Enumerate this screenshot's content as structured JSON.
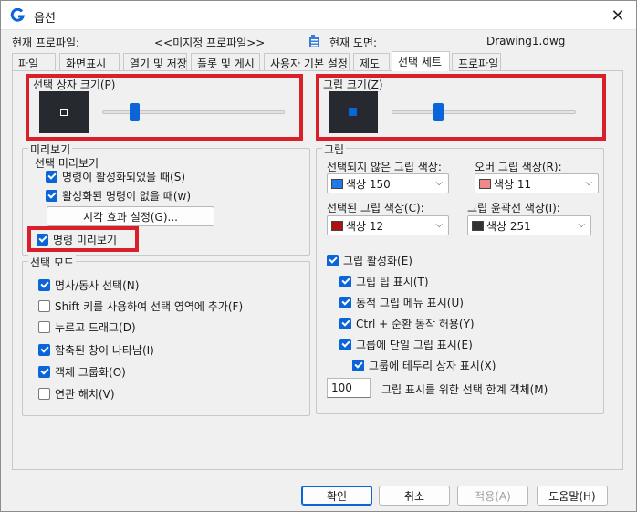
{
  "window": {
    "title": "옵션",
    "close_symbol": "✕"
  },
  "profile": {
    "current_profile_label": "현재 프로파일:",
    "current_profile_value": "<<미지정 프로파일>>",
    "current_drawing_label": "현재 도면:",
    "current_drawing_value": "Drawing1.dwg"
  },
  "tabs": [
    {
      "label": "파일"
    },
    {
      "label": "화면표시"
    },
    {
      "label": "열기 및 저장"
    },
    {
      "label": "플롯 및 게시"
    },
    {
      "label": "사용자 기본 설정"
    },
    {
      "label": "제도"
    },
    {
      "label": "선택 세트"
    },
    {
      "label": "프로파일"
    }
  ],
  "active_tab": "선택 세트",
  "pickbox": {
    "label": "선택 상자 크기(P)",
    "slider_value": 0.15
  },
  "gripsize": {
    "label": "그립 크기(Z)",
    "slider_value": 0.23
  },
  "preview": {
    "group_label": "미리보기",
    "sub_label": "선택 미리보기",
    "when_active": "명령이 활성화되었을 때(S)",
    "when_inactive": "활성화된 명령이 없을 때(w)",
    "visual_effects_button": "시각 효과 설정(G)...",
    "command_preview": "명령 미리보기"
  },
  "selection_modes": {
    "group_label": "선택 모드",
    "items": [
      {
        "label": "명사/동사 선택(N)",
        "checked": true
      },
      {
        "label": "Shift 키를 사용하여 선택 영역에 추가(F)",
        "checked": false
      },
      {
        "label": "누르고 드래그(D)",
        "checked": false
      },
      {
        "label": "함축된 창이 나타남(I)",
        "checked": true
      },
      {
        "label": "객체 그룹화(O)",
        "checked": true
      },
      {
        "label": "연관 해치(V)",
        "checked": false
      }
    ]
  },
  "grips": {
    "group_label": "그립",
    "unselected_label": "선택되지 않은 그립 색상:",
    "unselected_value": "색상 150",
    "hover_label": "오버 그립 색상(R):",
    "hover_value": "색상 11",
    "selected_label": "선택된 그립 색상(C):",
    "selected_value": "색상 12",
    "outline_label": "그립 윤곽선 색상(I):",
    "outline_value": "색상 251",
    "enable_grips": "그립 활성화(E)",
    "grip_tips": "그립 팁 표시(T)",
    "dynamic_menu": "동적 그립 메뉴 표시(U)",
    "ctrl_cycle": "Ctrl + 순환 동작 허용(Y)",
    "single_group": "그룹에 단일 그립 표시(E)",
    "bbox_group": "그룹에 테두리 상자 표시(X)",
    "limit_value": "100",
    "limit_label": "그립 표시를 위한 선택 한계 객체(M)"
  },
  "buttons": {
    "ok": "확인",
    "cancel": "취소",
    "apply": "적용(A)",
    "help": "도움말(H)"
  },
  "colors": {
    "accent": "#0a66d8",
    "highlight_red": "#d9202a",
    "swatch_150": "#1e7be6",
    "swatch_11": "#f08a8a",
    "swatch_12": "#b01010",
    "swatch_251": "#333333"
  }
}
